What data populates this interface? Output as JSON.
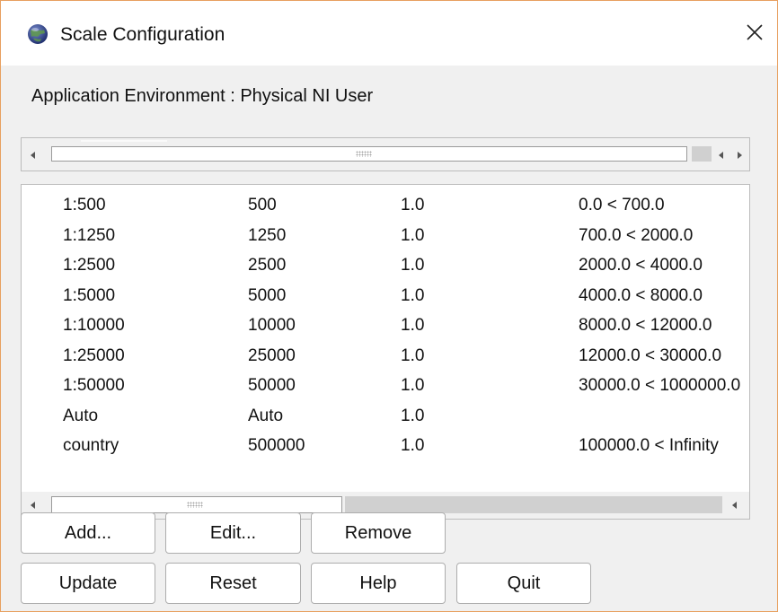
{
  "window": {
    "title": "Scale Configuration",
    "close_glyph": "✕",
    "icons": {
      "app": "globe-icon",
      "close": "close-icon"
    },
    "border_color": "#e8a060"
  },
  "environment": {
    "label": "Application Environment : Physical NI User"
  },
  "scales": [
    {
      "name": "1:500",
      "value": "500",
      "factor": "1.0",
      "range": "0.0 < 700.0"
    },
    {
      "name": "1:1250",
      "value": "1250",
      "factor": "1.0",
      "range": "700.0 < 2000.0"
    },
    {
      "name": "1:2500",
      "value": "2500",
      "factor": "1.0",
      "range": "2000.0 < 4000.0"
    },
    {
      "name": "1:5000",
      "value": "5000",
      "factor": "1.0",
      "range": "4000.0 < 8000.0"
    },
    {
      "name": "1:10000",
      "value": "10000",
      "factor": "1.0",
      "range": "8000.0 < 12000.0"
    },
    {
      "name": "1:25000",
      "value": "25000",
      "factor": "1.0",
      "range": "12000.0 < 30000.0"
    },
    {
      "name": "1:50000",
      "value": "50000",
      "factor": "1.0",
      "range": "30000.0 < 1000000.0"
    },
    {
      "name": "Auto",
      "value": "Auto",
      "factor": "1.0",
      "range": ""
    },
    {
      "name": "country",
      "value": "500000",
      "factor": "1.0",
      "range": "100000.0 < Infinity"
    }
  ],
  "buttons": {
    "add": "Add...",
    "edit": "Edit...",
    "remove": "Remove",
    "update": "Update",
    "reset": "Reset",
    "help": "Help",
    "quit": "Quit"
  }
}
